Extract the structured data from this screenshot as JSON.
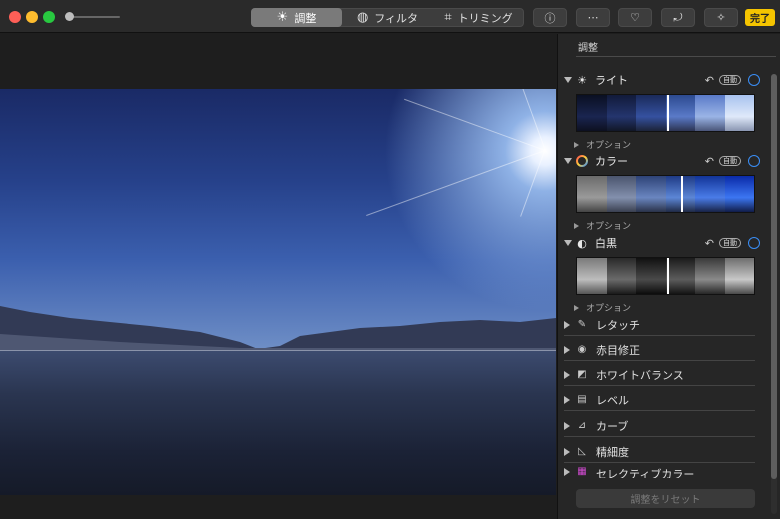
{
  "toolbar": {
    "tabs": [
      {
        "label": "調整",
        "icon": "adjust-sun-icon",
        "selected": true
      },
      {
        "label": "フィルタ",
        "icon": "filter-circles-icon",
        "selected": false
      },
      {
        "label": "トリミング",
        "icon": "crop-icon",
        "selected": false
      }
    ],
    "buttons": [
      {
        "name": "info-button",
        "icon": "info-icon",
        "glyph": "ⓘ"
      },
      {
        "name": "more-button",
        "icon": "ellipsis-icon",
        "glyph": "⋯"
      },
      {
        "name": "favorite-button",
        "icon": "heart-icon",
        "glyph": "♡"
      },
      {
        "name": "rotate-button",
        "icon": "rotate-icon",
        "glyph": "⤾"
      },
      {
        "name": "auto-enhance-button",
        "icon": "magic-wand-icon",
        "glyph": "✧"
      }
    ],
    "done_label": "完了",
    "done_color": "#f5c400"
  },
  "sidebar": {
    "title": "調整",
    "sections": [
      {
        "label": "ライト",
        "icon": "sun-icon",
        "auto": "自動",
        "option": "オプション",
        "toggle_color": "#3a8ef6"
      },
      {
        "label": "カラー",
        "icon": "color-wheel-icon",
        "auto": "自動",
        "option": "オプション",
        "toggle_color": "#3a8ef6"
      },
      {
        "label": "白黒",
        "icon": "black-white-icon",
        "auto": "自動",
        "option": "オプション",
        "toggle_color": "#3a8ef6"
      }
    ],
    "tools": [
      {
        "label": "レタッチ",
        "icon": "bandage-icon"
      },
      {
        "label": "赤目修正",
        "icon": "eye-icon"
      },
      {
        "label": "ホワイトバランス",
        "icon": "white-balance-icon"
      },
      {
        "label": "レベル",
        "icon": "levels-icon"
      },
      {
        "label": "カーブ",
        "icon": "curves-icon"
      },
      {
        "label": "精細度",
        "icon": "definition-icon"
      },
      {
        "label": "セレクティブカラー",
        "icon": "selective-color-icon"
      }
    ],
    "reset_label": "調整をリセット"
  }
}
